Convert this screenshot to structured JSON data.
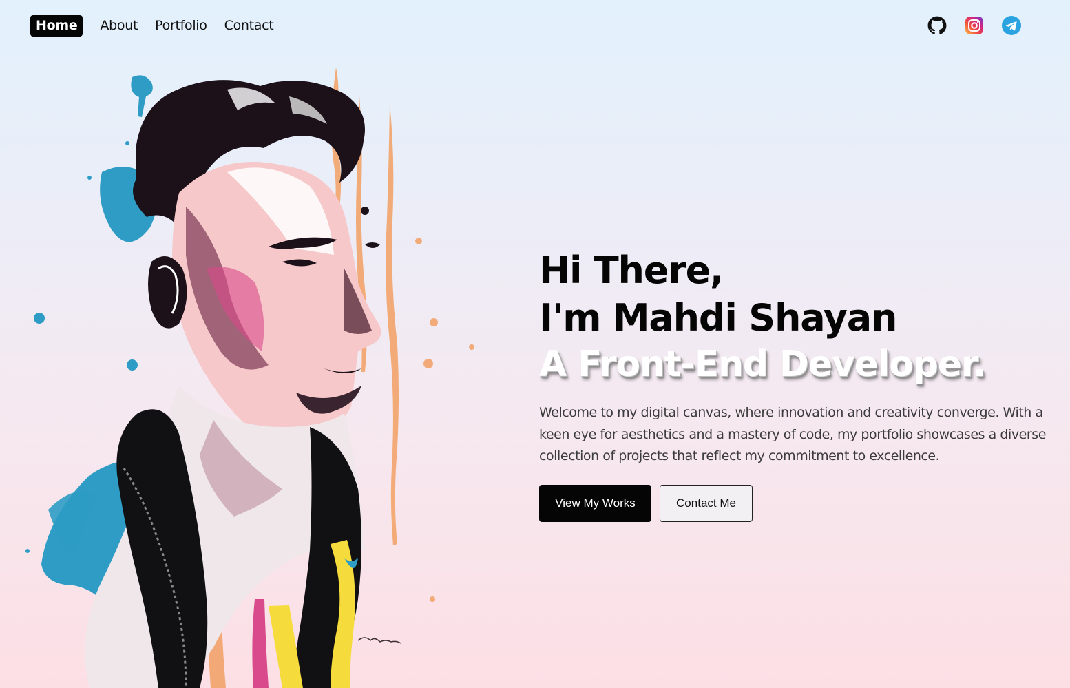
{
  "nav": {
    "items": [
      {
        "label": "Home",
        "active": true
      },
      {
        "label": "About",
        "active": false
      },
      {
        "label": "Portfolio",
        "active": false
      },
      {
        "label": "Contact",
        "active": false
      }
    ]
  },
  "socials": [
    {
      "icon": "github-icon"
    },
    {
      "icon": "instagram-icon"
    },
    {
      "icon": "telegram-icon"
    }
  ],
  "hero": {
    "greeting": "Hi There,",
    "name_line": "I'm Mahdi Shayan",
    "role": "A Front-End Developer.",
    "intro": "Welcome to my digital canvas, where innovation and creativity converge. With a keen eye for aesthetics and a mastery of code, my portfolio showcases a diverse collection of projects that reflect my commitment to excellence.",
    "primary_button": "View My Works",
    "secondary_button": "Contact Me"
  },
  "colors": {
    "accent": "#050505",
    "telegram": "#2aa3e0",
    "paint_blue": "#2e9cc4",
    "paint_orange": "#f2a46b",
    "paint_pink": "#d94a8c",
    "paint_yellow": "#f5dc3c"
  }
}
